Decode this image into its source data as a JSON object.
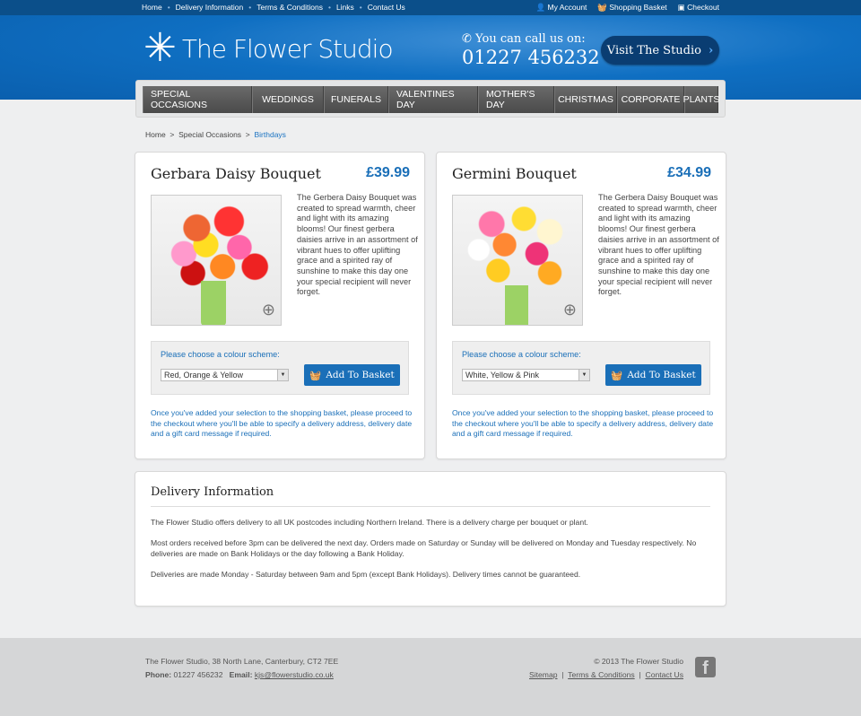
{
  "topbar": {
    "links": [
      "Home",
      "Delivery Information",
      "Terms & Conditions",
      "Links",
      "Contact Us"
    ],
    "account": "My Account",
    "basket": "Shopping Basket",
    "checkout": "Checkout"
  },
  "header": {
    "logo": "The Flower Studio",
    "call_label": "You can call us on:",
    "phone": "01227 456232",
    "visit": "Visit The Studio"
  },
  "nav": [
    "SPECIAL OCCASIONS",
    "WEDDINGS",
    "FUNERALS",
    "VALENTINES DAY",
    "MOTHER'S DAY",
    "CHRISTMAS",
    "CORPORATE",
    "PLANTS"
  ],
  "breadcrumb": {
    "home": "Home",
    "sep": ">",
    "parent": "Special Occasions",
    "current": "Birthdays"
  },
  "products": [
    {
      "title": "Gerbara Daisy Bouquet",
      "price": "£39.99",
      "description": "The Gerbera Daisy Bouquet was created to spread warmth, cheer and light with its amazing blooms! Our finest gerbera daisies arrive in an assortment of vibrant hues to offer uplifting grace and a spirited ray of sunshine to make this day one your special recipient will never forget.",
      "colour_label": "Please choose a colour scheme:",
      "colour": "Red, Orange & Yellow",
      "add": "Add To Basket",
      "note": "Once you've added your selection to the shopping basket, please proceed to the checkout where you'll be able to specify a delivery address, delivery date and a gift card message if required."
    },
    {
      "title": "Germini Bouquet",
      "price": "£34.99",
      "description": "The Gerbera Daisy Bouquet was created to spread warmth, cheer and light with its amazing blooms! Our finest gerbera daisies arrive in an assortment of vibrant hues to offer uplifting grace and a spirited ray of sunshine to make this day one your special recipient will never forget.",
      "colour_label": "Please choose a colour scheme:",
      "colour": "White, Yellow & Pink",
      "add": "Add To Basket",
      "note": "Once you've added your selection to the shopping basket, please proceed to the checkout where you'll be able to specify a delivery address, delivery date and a gift card message if required."
    }
  ],
  "delivery": {
    "title": "Delivery Information",
    "paragraphs": [
      "The Flower Studio offers delivery to all UK postcodes including Northern Ireland. There is a delivery charge per bouquet or plant.",
      "Most orders received before 3pm can be delivered the next day. Orders made on Saturday or Sunday will be delivered on Monday and Tuesday respectively. No deliveries are made on Bank Holidays or the day following a Bank Holiday.",
      "Deliveries are made Monday - Saturday between 9am and 5pm (except Bank Holidays). Delivery times cannot be guaranteed."
    ]
  },
  "footer": {
    "address": "The Flower Studio, 38 North Lane, Canterbury, CT2 7EE",
    "phone_label": "Phone:",
    "phone": "01227 456232",
    "email_label": "Email:",
    "email": "kjs@flowerstudio.co.uk",
    "copyright": "© 2013 The Flower Studio",
    "sitemap": "Sitemap",
    "terms": "Terms & Conditions",
    "contact": "Contact Us"
  }
}
